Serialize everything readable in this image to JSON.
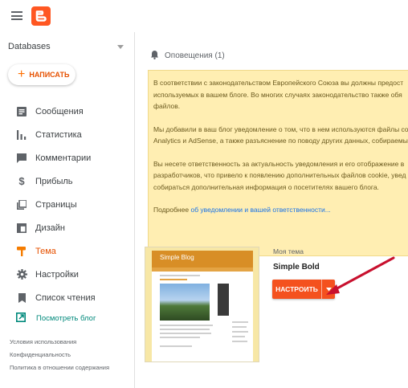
{
  "app": {
    "logo_icon": "blogger-logo",
    "brand_color": "#ff5722"
  },
  "sidebar": {
    "blog_name": "Databases",
    "new_post_label": "НАПИСАТЬ",
    "items": [
      {
        "label": "Сообщения",
        "icon": "posts-icon"
      },
      {
        "label": "Статистика",
        "icon": "stats-icon"
      },
      {
        "label": "Комментарии",
        "icon": "comments-icon"
      },
      {
        "label": "Прибыль",
        "icon": "earnings-icon"
      },
      {
        "label": "Страницы",
        "icon": "pages-icon"
      },
      {
        "label": "Дизайн",
        "icon": "layout-icon"
      },
      {
        "label": "Тема",
        "icon": "theme-icon",
        "active": true
      },
      {
        "label": "Настройки",
        "icon": "settings-icon"
      },
      {
        "label": "Список чтения",
        "icon": "reading-list-icon"
      }
    ],
    "view_blog_label": "Посмотреть блог",
    "footer": [
      "Условия использования",
      "Конфиденциальность",
      "Политика в отношении содержания"
    ]
  },
  "main": {
    "notifications_title": "Оповещения (1)",
    "notice": {
      "p1": [
        "В соответствии с законодательством Европейского Союза вы должны предост",
        "используемых в вашем блоге. Во многих случаях законодательство также обя",
        "файлов."
      ],
      "p2": [
        "Мы добавили в ваш блог уведомление о том, что в нем используются файлы co",
        "Analytics и AdSense, а также разъяснение по поводу других данных, собираемы"
      ],
      "p3": [
        "Вы несете ответственность за актуальность уведомления и его отображение в",
        "разработчиков, что привело к появлению дополнительных файлов cookie, увед",
        "собираться дополнительная информация о посетителях вашего блога."
      ],
      "more_prefix": "Подробнее",
      "more_link": "об уведомлении и вашей ответственности..."
    },
    "theme": {
      "my_theme_label": "Моя тема",
      "name": "Simple Bold",
      "preview_title": "Simple Blog",
      "customize_label": "НАСТРОИТЬ"
    },
    "accent_color": "#f4511e",
    "annotation_color": "#c8102e"
  }
}
